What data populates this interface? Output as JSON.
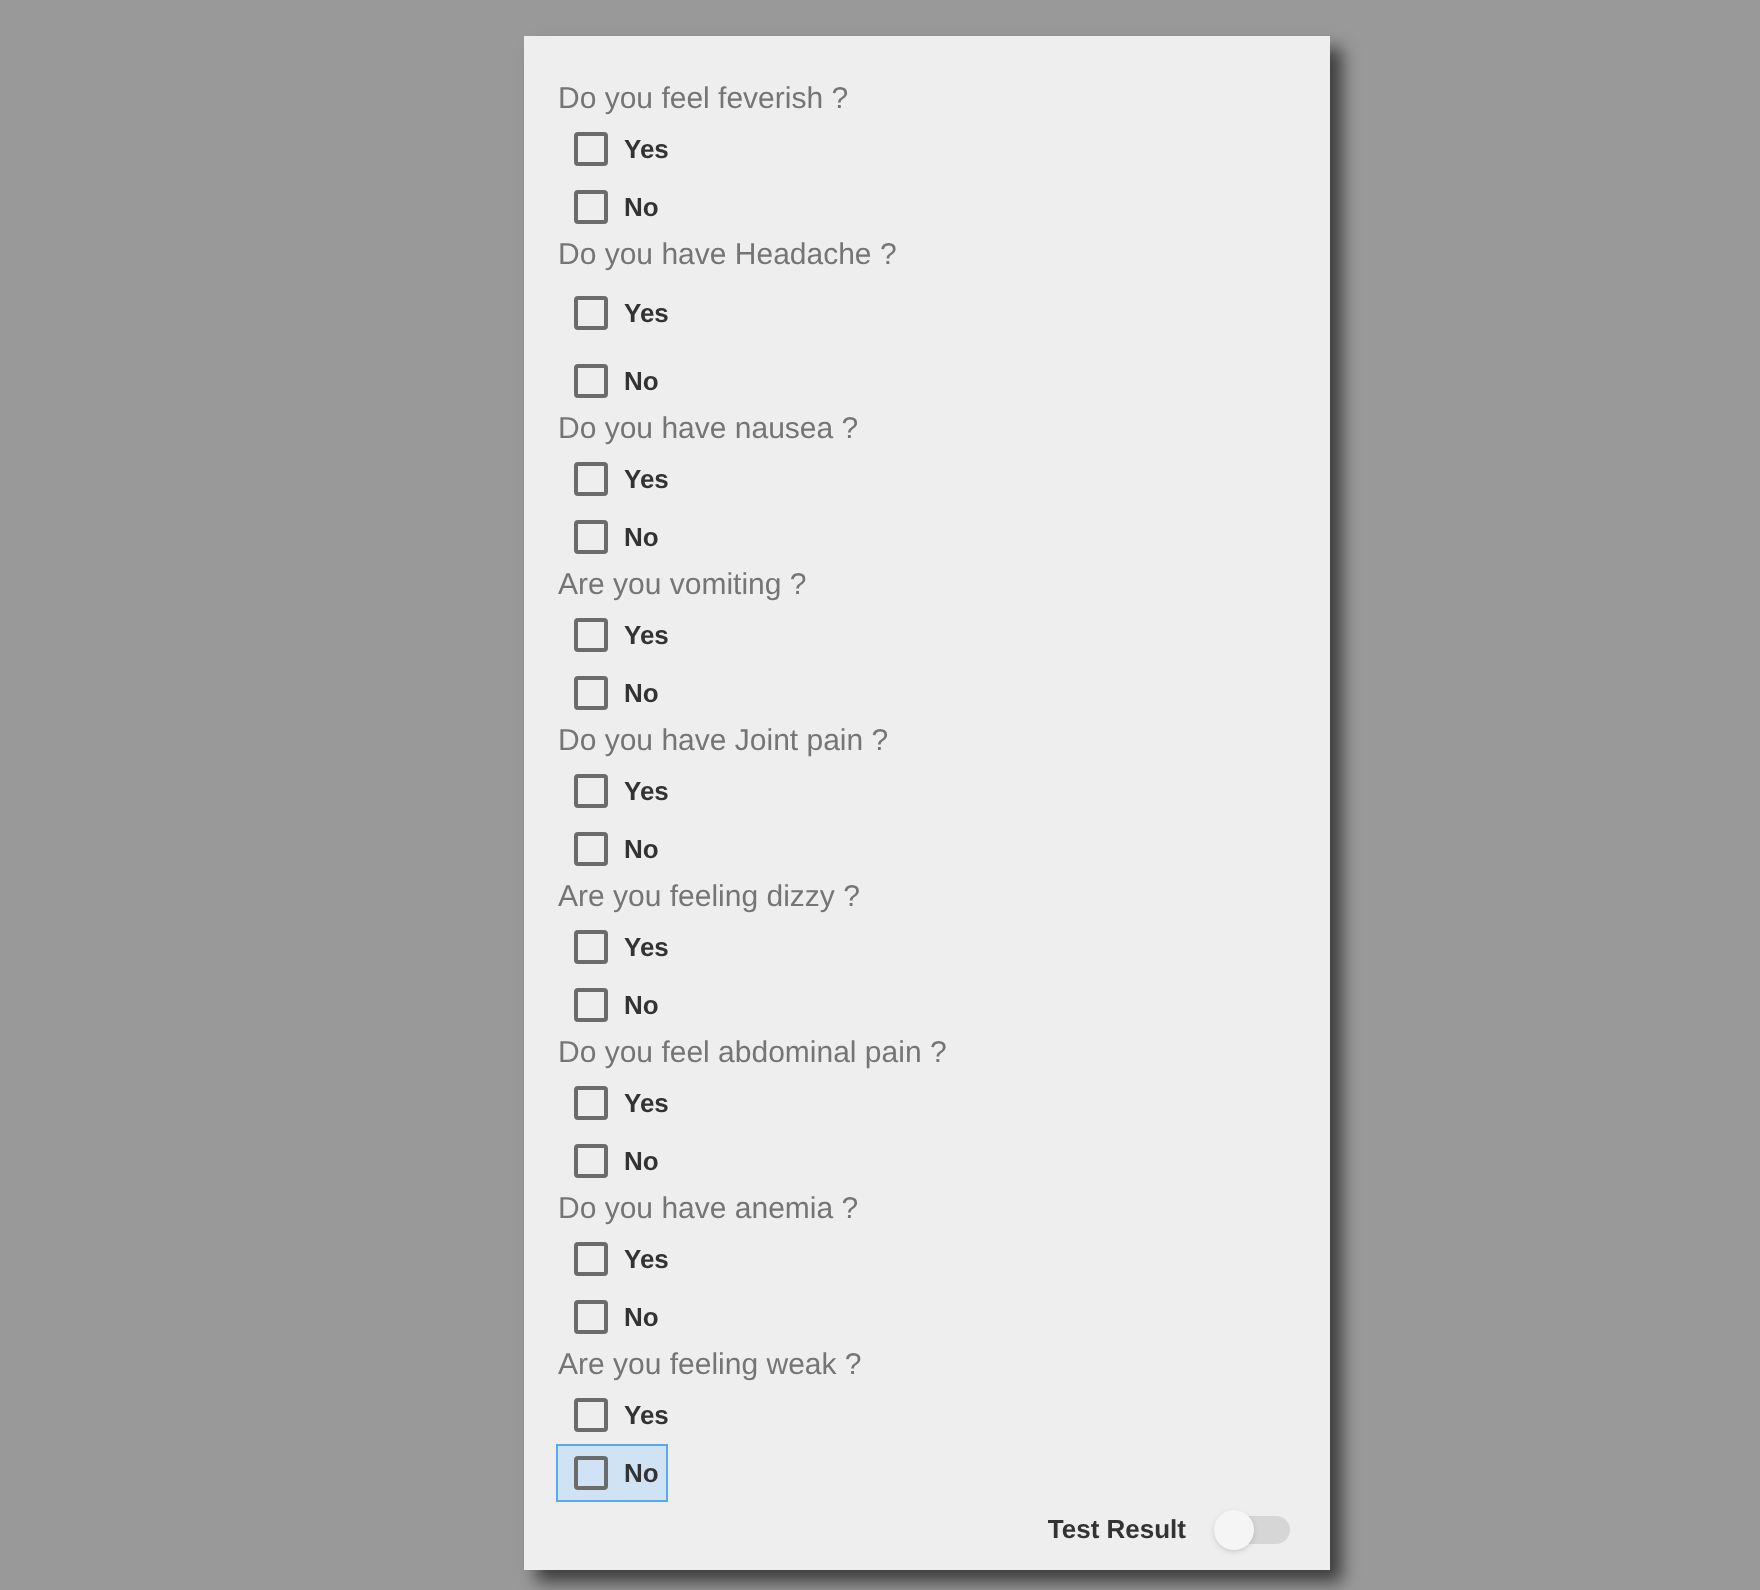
{
  "questions": [
    {
      "text": "Do you feel feverish ?",
      "options": [
        {
          "label": "Yes",
          "checked": false,
          "selected": false
        },
        {
          "label": "No",
          "checked": false,
          "selected": false
        }
      ]
    },
    {
      "text": "Do you have Headache ?",
      "options": [
        {
          "label": "Yes",
          "checked": false,
          "selected": false
        },
        {
          "label": "No",
          "checked": false,
          "selected": false
        }
      ]
    },
    {
      "text": "Do you have nausea ?",
      "options": [
        {
          "label": "Yes",
          "checked": false,
          "selected": false
        },
        {
          "label": "No",
          "checked": false,
          "selected": false
        }
      ]
    },
    {
      "text": "Are you vomiting ?",
      "options": [
        {
          "label": "Yes",
          "checked": false,
          "selected": false
        },
        {
          "label": "No",
          "checked": false,
          "selected": false
        }
      ]
    },
    {
      "text": "Do you have Joint pain ?",
      "options": [
        {
          "label": "Yes",
          "checked": false,
          "selected": false
        },
        {
          "label": "No",
          "checked": false,
          "selected": false
        }
      ]
    },
    {
      "text": "Are you feeling dizzy ?",
      "options": [
        {
          "label": "Yes",
          "checked": false,
          "selected": false
        },
        {
          "label": "No",
          "checked": false,
          "selected": false
        }
      ]
    },
    {
      "text": "Do you feel abdominal pain ?",
      "options": [
        {
          "label": "Yes",
          "checked": false,
          "selected": false
        },
        {
          "label": "No",
          "checked": false,
          "selected": false
        }
      ]
    },
    {
      "text": "Do you have anemia ?",
      "options": [
        {
          "label": "Yes",
          "checked": false,
          "selected": false
        },
        {
          "label": "No",
          "checked": false,
          "selected": false
        }
      ]
    },
    {
      "text": "Are you feeling weak ?",
      "options": [
        {
          "label": "Yes",
          "checked": false,
          "selected": false
        },
        {
          "label": "No",
          "checked": false,
          "selected": true
        }
      ]
    }
  ],
  "test_result": {
    "label": "Test Result",
    "on": false
  }
}
